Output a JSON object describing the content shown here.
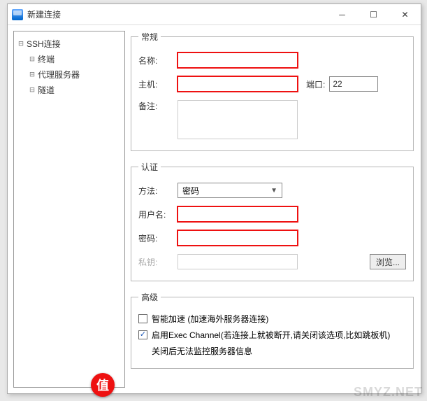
{
  "window": {
    "title": "新建连接"
  },
  "tree": {
    "root": {
      "label": "SSH连接"
    },
    "children": [
      {
        "label": "终端"
      },
      {
        "label": "代理服务器"
      },
      {
        "label": "隧道"
      }
    ]
  },
  "general": {
    "legend": "常规",
    "name_label": "名称:",
    "name_value": "",
    "host_label": "主机:",
    "host_value": "",
    "port_label": "端口:",
    "port_value": "22",
    "remark_label": "备注:",
    "remark_value": ""
  },
  "auth": {
    "legend": "认证",
    "method_label": "方法:",
    "method_value": "密码",
    "user_label": "用户名:",
    "user_value": "",
    "pass_label": "密码:",
    "pass_value": "",
    "key_label": "私钥:",
    "browse": "浏览..."
  },
  "advanced": {
    "legend": "高级",
    "smart_accel": "智能加速 (加速海外服务器连接)",
    "exec_channel": "启用Exec Channel(若连接上就被断开,请关闭该选项,比如跳板机)",
    "exec_note": "关闭后无法监控服务器信息"
  },
  "watermark": "SMYZ.NET",
  "badge": "值"
}
